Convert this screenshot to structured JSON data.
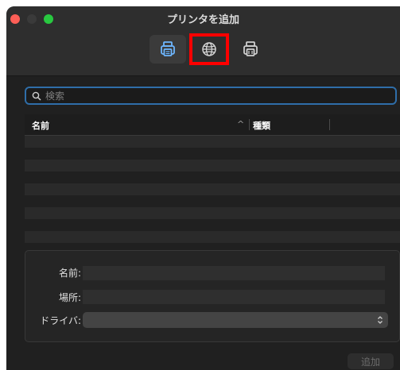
{
  "window": {
    "title": "プリンタを追加"
  },
  "toolbar": {
    "buttons": [
      {
        "icon": "default-printer-icon",
        "selected": true
      },
      {
        "icon": "ip-globe-icon",
        "highlighted": true
      },
      {
        "icon": "windows-printer-icon",
        "selected": false
      }
    ]
  },
  "search": {
    "placeholder": "検索",
    "value": ""
  },
  "list": {
    "columns": {
      "name": "名前",
      "kind": "種類"
    },
    "sort_indicator": "^",
    "rows": []
  },
  "form": {
    "name_label": "名前:",
    "location_label": "場所:",
    "driver_label": "ドライバ:",
    "name_value": "",
    "location_value": "",
    "driver_value": ""
  },
  "footer": {
    "add_label": "追加"
  },
  "colors": {
    "accent": "#2f6ea9",
    "highlight_box": "#ff0000",
    "close": "#fe5f57",
    "maximize": "#28c840"
  }
}
